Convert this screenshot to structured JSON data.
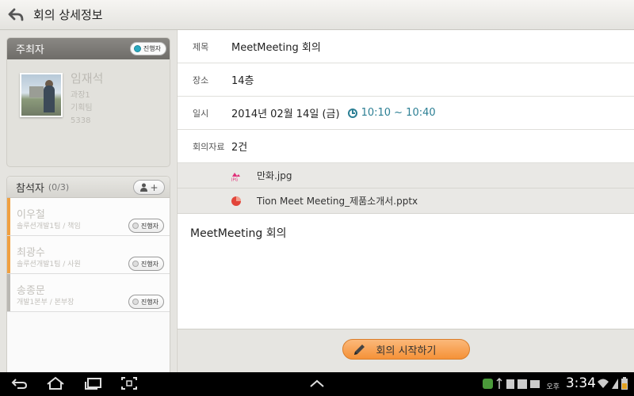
{
  "header": {
    "title": "회의 상세정보",
    "back_icon": "back-arrow-icon",
    "chat_icon": "chat-bubble-icon",
    "refresh_icon": "refresh-icon"
  },
  "host": {
    "section_label": "주최자",
    "status": "진행자",
    "name": "임재석",
    "rank": "과장1",
    "dept": "기획팀",
    "ext": "5338"
  },
  "attendees": {
    "section_label": "참석자",
    "count": "(0/3)",
    "add_label": "+",
    "items": [
      {
        "name": "이우철",
        "dept": "솔루션개발1팀 / 책임",
        "status": "진행자",
        "bar_color": "#f0a040"
      },
      {
        "name": "최광수",
        "dept": "솔루션개발1팀 / 사원",
        "status": "진행자",
        "bar_color": "#f0a040"
      },
      {
        "name": "송종문",
        "dept": "개발1본부 / 본부장",
        "status": "진행자",
        "bar_color": "#b9b7b2"
      }
    ]
  },
  "details": {
    "title_label": "제목",
    "title_value": "MeetMeeting 회의",
    "place_label": "장소",
    "place_value": "14층",
    "date_label": "일시",
    "date_value": "2014년 02월 14일 (금)",
    "time_value": "10:10 ~ 10:40",
    "docs_label": "회의자료",
    "docs_value": "2건"
  },
  "files": [
    {
      "name": "만화.jpg",
      "icon": "jpg-file-icon"
    },
    {
      "name": "Tion Meet Meeting_제품소개서.pptx",
      "icon": "pptx-file-icon"
    }
  ],
  "description": "MeetMeeting 회의",
  "start_button": "회의 시작하기",
  "system": {
    "ampm": "오후",
    "time": "3:34"
  }
}
